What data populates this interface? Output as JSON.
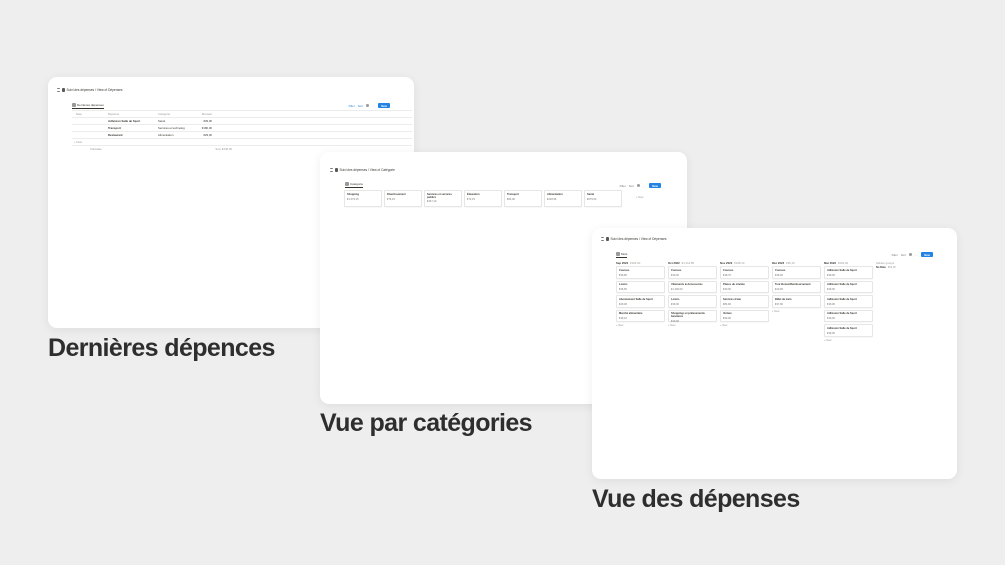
{
  "captions": {
    "latest": "Dernières dépences",
    "categories": "Vue par catégories",
    "expenses": "Vue des dépenses"
  },
  "window1": {
    "breadcrumb": "Suivi des dépenses / View of Dépenses",
    "view_tab": "Dernières dépenses",
    "toolbar": {
      "filter": "Filter",
      "sort": "Sort",
      "new": "New"
    },
    "columns": [
      "Date",
      "Dépense",
      "Catégorie",
      "Montant"
    ],
    "rows": [
      {
        "date": "",
        "name": "Adhésion Salle de Sport",
        "category": "Santé",
        "amount": "€39,00"
      },
      {
        "date": "",
        "name": "Transport",
        "category": "Services et technolog",
        "amount": "€180,00"
      },
      {
        "date": "",
        "name": "Restaurant",
        "category": "Alimentation",
        "amount": "€29,00"
      }
    ],
    "new_row": "+ New",
    "calculate": "Calculate",
    "sum": "Sum €248,00"
  },
  "window2": {
    "breadcrumb": "Suivi des dépenses / View of Catégorie",
    "view_tab": "Catégorie",
    "toolbar": {
      "filter": "Filter",
      "sort": "Sort",
      "new": "New"
    },
    "categories": [
      {
        "name": "Shopping",
        "amount": "€1 079,15"
      },
      {
        "name": "Divertissement",
        "amount": "€76,15"
      },
      {
        "name": "Services et services publics",
        "amount": "€347,10"
      },
      {
        "name": "Éducation",
        "amount": "€72,15"
      },
      {
        "name": "Transport",
        "amount": "€82,00"
      },
      {
        "name": "Alimentation",
        "amount": "€218,96"
      },
      {
        "name": "Santé",
        "amount": "€679,00"
      }
    ],
    "new_group": "+ New"
  },
  "window3": {
    "breadcrumb": "Suivi des dépenses / View of Dépenses",
    "view_tab": "Mois",
    "toolbar": {
      "filter": "Filter",
      "sort": "Sort",
      "new": "New"
    },
    "columns": [
      {
        "title": "Sep 2022",
        "total": "€163,90",
        "cards": [
          {
            "name": "Courses",
            "amount": "€36,80"
          },
          {
            "name": "Loisirs",
            "amount": "€36,50"
          },
          {
            "name": "Abonnement Salle de Sport",
            "amount": "€29,00"
          },
          {
            "name": "Marché alimentaire",
            "amount": "€39,10"
          }
        ]
      },
      {
        "title": "Oct 2022",
        "total": "€1 413,85",
        "cards": [
          {
            "name": "Courses",
            "amount": "€30,00"
          },
          {
            "name": "Vêtements & Accessoires",
            "amount": "€1 200,00"
          },
          {
            "name": "Loisirs",
            "amount": "€39,00"
          },
          {
            "name": "Shoppings et prélevements bancaires",
            "amount": "€40,00"
          }
        ]
      },
      {
        "title": "Nov 2022",
        "total": "€238,10",
        "cards": [
          {
            "name": "Courses",
            "amount": "€48,70"
          },
          {
            "name": "Places de cinéma",
            "amount": "€30,00"
          },
          {
            "name": "Services d'eau",
            "amount": "€84,90"
          },
          {
            "name": "Voiture",
            "amount": "€90,00"
          }
        ]
      },
      {
        "title": "Déc 2022",
        "total": "€96,10",
        "cards": [
          {
            "name": "Courses",
            "amount": "€28,40"
          },
          {
            "name": "Tour Bonus/Remboursement",
            "amount": "€20,00"
          },
          {
            "name": "Billet de train",
            "amount": "€37,90"
          }
        ]
      },
      {
        "title": "Mar 2023",
        "total": "€262,00",
        "cards": [
          {
            "name": "Adhésion Salle de Sport",
            "amount": "€39,00"
          },
          {
            "name": "Adhésion Salle de Sport",
            "amount": "€39,00"
          },
          {
            "name": "Adhésion Salle de Sport",
            "amount": "€39,00"
          },
          {
            "name": "Adhésion Salle de Sport",
            "amount": "€39,00"
          },
          {
            "name": "Adhésion Salle de Sport",
            "amount": "€39,00"
          }
        ]
      }
    ],
    "new_row": "+ New",
    "hidden_groups_label": "Hidden groups",
    "hidden_group": {
      "name": "No Date",
      "count": "€52,00"
    }
  }
}
